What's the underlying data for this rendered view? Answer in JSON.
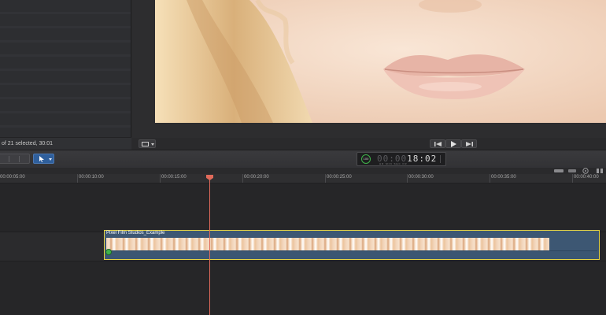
{
  "browser": {
    "status": "of 21 selected, 30:01"
  },
  "dashboard": {
    "ring_label": "100",
    "timecode_dim": "00:00",
    "timecode_bright": "18:02",
    "units": "HR MIN SEC FR"
  },
  "ruler": {
    "ticks": [
      "00:00:05:00",
      "00:00:10:00",
      "00:00:15:00",
      "00:00:20:00",
      "00:00:25:00",
      "00:00:30:00",
      "00:00:35:00",
      "00:00:40:00"
    ]
  },
  "clip": {
    "name": "Pixel Film Studios_Example"
  },
  "colors": {
    "clip_border": "#e6d443",
    "clip_fill": "#3d5773",
    "playhead": "#e06a5a",
    "accent_green": "#3fb24a"
  },
  "icons": [
    "crop-icon",
    "rewind-icon",
    "play-icon",
    "forward-icon",
    "select-tool-icon",
    "skimming-icon",
    "audio-skimming-icon",
    "solo-icon",
    "snapping-icon"
  ]
}
